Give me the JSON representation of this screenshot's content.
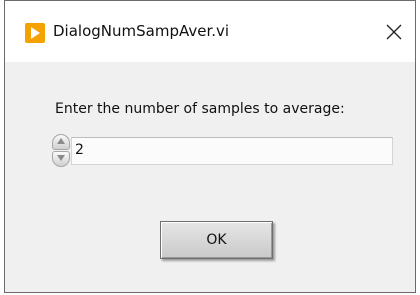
{
  "window": {
    "title": "DialogNumSampAver.vi",
    "app_icon": "labview-icon",
    "close_icon": "close-icon",
    "accent_color": "#f5a200"
  },
  "dialog": {
    "prompt_label": "Enter the number of samples to average:",
    "samples_value": "2",
    "ok_label": "OK"
  }
}
